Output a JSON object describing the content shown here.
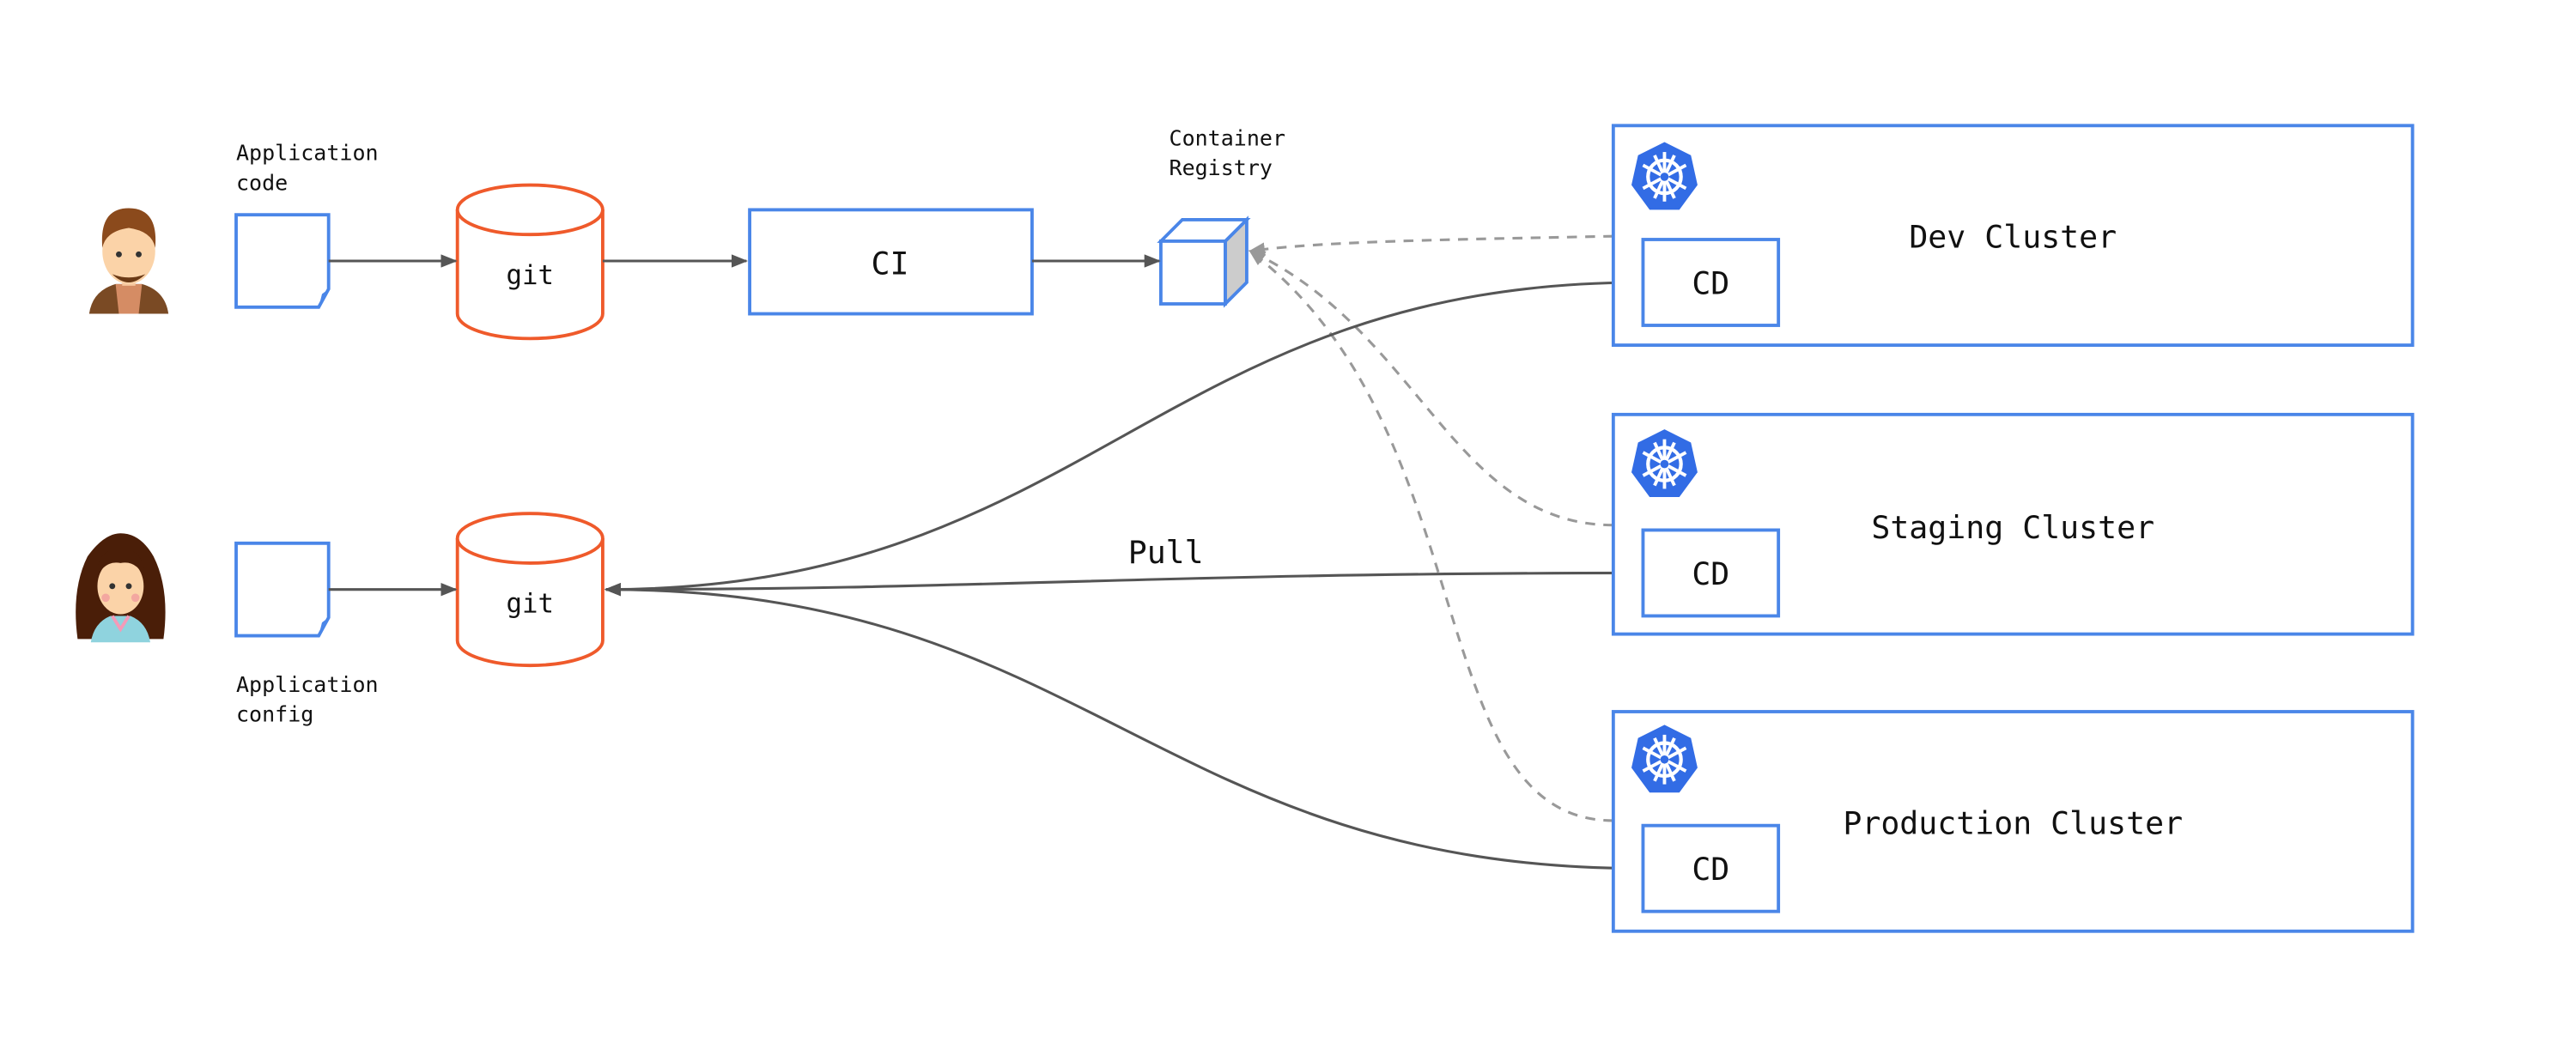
{
  "labels": {
    "app_code": [
      "Application",
      "code"
    ],
    "app_config": [
      "Application",
      "config"
    ],
    "git": "git",
    "ci": "CI",
    "registry": [
      "Container",
      "Registry"
    ],
    "pull": "Pull",
    "cd": "CD"
  },
  "clusters": [
    {
      "name": "Dev Cluster"
    },
    {
      "name": "Staging Cluster"
    },
    {
      "name": "Production Cluster"
    }
  ],
  "colors": {
    "accent_blue": "#4a86e8",
    "git_orange": "#ef5a2b",
    "k8s_blue": "#326ce5",
    "line": "#555555",
    "dashed": "#999999"
  }
}
